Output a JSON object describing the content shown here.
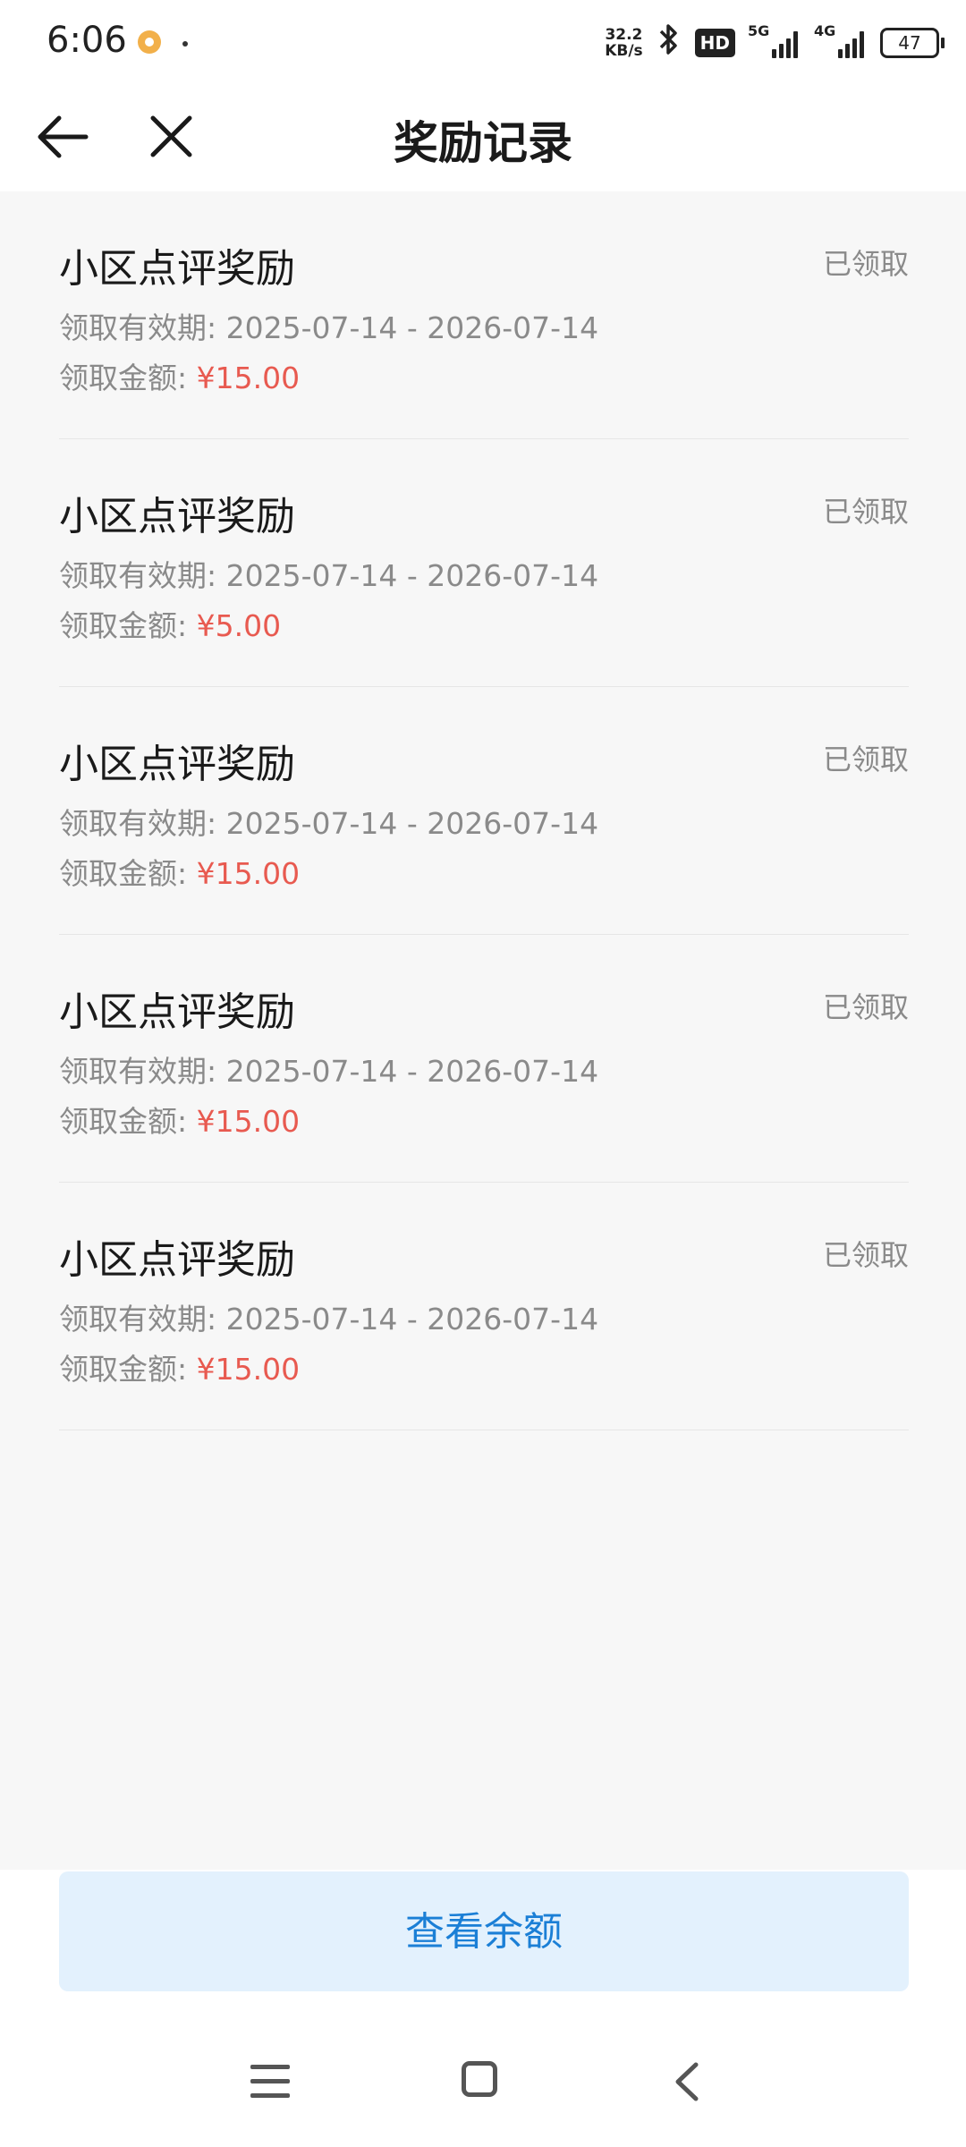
{
  "status_bar": {
    "time": "6:06",
    "net_speed_value": "32.2",
    "net_speed_unit": "KB/s",
    "hd_label": "HD",
    "signal_5g": "5G",
    "signal_4g": "4G",
    "battery": "47",
    "icons": [
      "app-notification-icon",
      "bluetooth-icon",
      "hd-voice-icon",
      "signal-icon",
      "battery-icon"
    ]
  },
  "header": {
    "title": "奖励记录"
  },
  "records": [
    {
      "title": "小区点评奖励",
      "status": "已领取",
      "valid_label": "领取有效期:",
      "valid_range": "2025-07-14 - 2026-07-14",
      "amount_label": "领取金额:",
      "amount": "¥15.00"
    },
    {
      "title": "小区点评奖励",
      "status": "已领取",
      "valid_label": "领取有效期:",
      "valid_range": "2025-07-14 - 2026-07-14",
      "amount_label": "领取金额:",
      "amount": "¥5.00"
    },
    {
      "title": "小区点评奖励",
      "status": "已领取",
      "valid_label": "领取有效期:",
      "valid_range": "2025-07-14 - 2026-07-14",
      "amount_label": "领取金额:",
      "amount": "¥15.00"
    },
    {
      "title": "小区点评奖励",
      "status": "已领取",
      "valid_label": "领取有效期:",
      "valid_range": "2025-07-14 - 2026-07-14",
      "amount_label": "领取金额:",
      "amount": "¥15.00"
    },
    {
      "title": "小区点评奖励",
      "status": "已领取",
      "valid_label": "领取有效期:",
      "valid_range": "2025-07-14 - 2026-07-14",
      "amount_label": "领取金额:",
      "amount": "¥15.00"
    }
  ],
  "footer": {
    "balance_button": "查看余额"
  },
  "colors": {
    "accent": "#1b7fd6",
    "button_bg": "#e3f1fd",
    "amount": "#e85a50",
    "muted_text": "#8a8a8a"
  }
}
